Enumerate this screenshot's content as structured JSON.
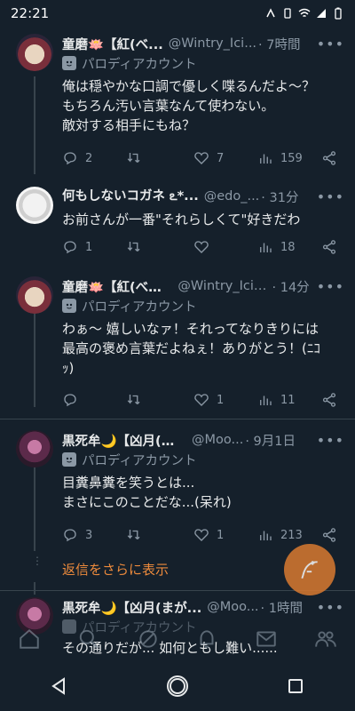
{
  "status_bar": {
    "time": "22:21"
  },
  "tweets": [
    {
      "display_name": "童磨🪷【紅(ベ...",
      "handle": "@Wintry_Ici...",
      "time": "· 7時間",
      "parody_label": "パロディアカウント",
      "text": "俺は穏やかな口調で優しく喋るんだよ〜？\nもちろん汚い言葉なんて使わない。\n敵対する相手にもね？",
      "replies": "2",
      "retweets": "",
      "likes": "7",
      "views": "159"
    },
    {
      "display_name": "何もしないコガネ ఽ*...",
      "handle": "@edo_...",
      "time": "· 31分",
      "text": "お前さんが一番\"それらしくて\"好きだわ",
      "replies": "1",
      "retweets": "",
      "likes": "",
      "views": "18"
    },
    {
      "display_name": "童磨🪷【紅(べに...",
      "handle": "@Wintry_Icic...",
      "time": "· 14分",
      "parody_label": "パロディアカウント",
      "text": "わぁ〜 嬉しいなァ！それってなりきりには\n最高の褒め言葉だよねぇ！ありがとう！(ﾆｺ\nｯ)",
      "replies": "",
      "retweets": "",
      "likes": "1",
      "views": "11"
    },
    {
      "display_name": "黒死牟🌙【凶月(ま...",
      "handle": "@Moo...",
      "time": "· 9月1日",
      "parody_label": "パロディアカウント",
      "text": "目糞鼻糞を笑うとは...\nまさにこのことだな...(呆れ)",
      "replies": "3",
      "retweets": "",
      "likes": "1",
      "views": "213"
    },
    {
      "display_name": "黒死牟🌙【凶月(まが...",
      "handle": "@Moo...",
      "time": "· 1時間",
      "parody_label": "パロディアカウント",
      "text": "その通りだが... 如何ともし難い......"
    }
  ],
  "show_more_label": "返信をさらに表示",
  "colors": {
    "background": "#15202b",
    "accent": "#d97a30",
    "muted": "#8b98a5"
  }
}
